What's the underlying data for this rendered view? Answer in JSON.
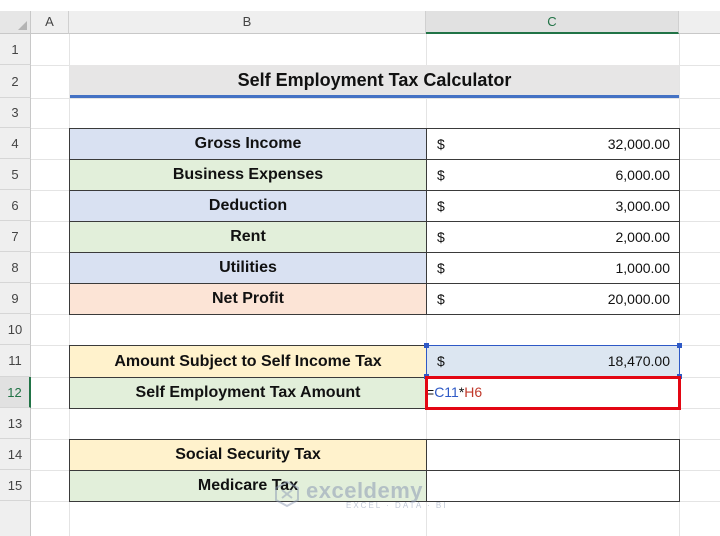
{
  "columns": {
    "a": "A",
    "b": "B",
    "c": "C"
  },
  "rows": [
    "1",
    "2",
    "3",
    "4",
    "5",
    "6",
    "7",
    "8",
    "9",
    "10",
    "11",
    "12",
    "13",
    "14",
    "15"
  ],
  "title": "Self Employment Tax Calculator",
  "income_table": [
    {
      "label": "Gross Income",
      "currency": "$",
      "amount": "32,000.00",
      "bg": "#d9e1f2"
    },
    {
      "label": "Business Expenses",
      "currency": "$",
      "amount": "6,000.00",
      "bg": "#e2efda"
    },
    {
      "label": "Deduction",
      "currency": "$",
      "amount": "3,000.00",
      "bg": "#d9e1f2"
    },
    {
      "label": "Rent",
      "currency": "$",
      "amount": "2,000.00",
      "bg": "#e2efda"
    },
    {
      "label": "Utilities",
      "currency": "$",
      "amount": "1,000.00",
      "bg": "#d9e1f2"
    },
    {
      "label": "Net Profit",
      "currency": "$",
      "amount": "20,000.00",
      "bg": "#fce4d6"
    }
  ],
  "tax_table": {
    "subject_label": "Amount Subject to Self Income Tax",
    "subject_currency": "$",
    "subject_amount": "18,470.00",
    "tax_label": "Self Employment Tax Amount",
    "formula": {
      "eq": "=",
      "ref1": "C11",
      "op": "*",
      "ref2": "H6"
    }
  },
  "breakdown_table": [
    {
      "label": "Social Security Tax",
      "bg": "#fff2cc"
    },
    {
      "label": "Medicare Tax",
      "bg": "#e2efda"
    }
  ],
  "watermark": {
    "name": "exceldemy",
    "sub": "EXCEL · DATA · BI"
  },
  "colors": {
    "selection": "#217346",
    "highlight": "#e30613",
    "ref_blue": "#2e59c6",
    "ref_red": "#c0392b"
  }
}
